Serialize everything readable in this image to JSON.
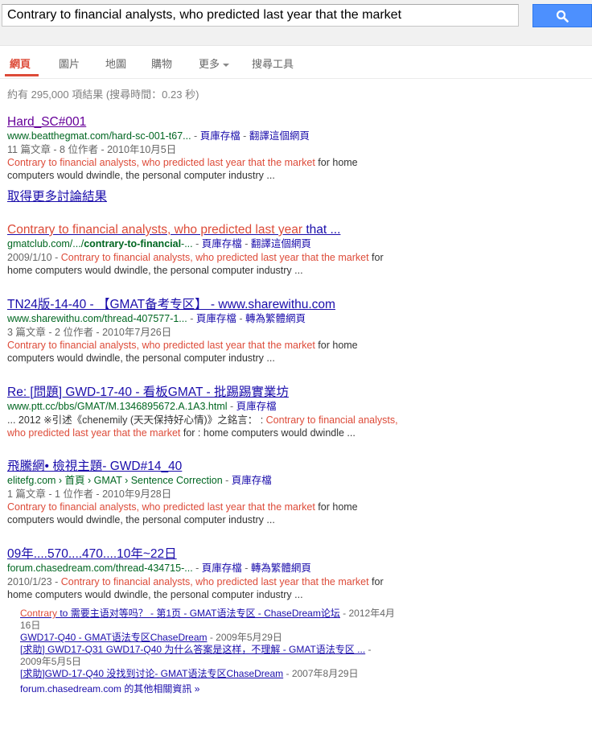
{
  "search": {
    "query": "Contrary to financial analysts, who predicted last year that the market",
    "button_icon": "search-icon",
    "accent_color": "#4d90fe"
  },
  "tabs": [
    {
      "label": "網頁",
      "active": true
    },
    {
      "label": "圖片"
    },
    {
      "label": "地圖"
    },
    {
      "label": "購物"
    },
    {
      "label": "更多"
    },
    {
      "label": "搜尋工具"
    }
  ],
  "stats": "約有 295,000 項結果 (搜尋時間：0.23 秒)",
  "results": [
    {
      "title": "Hard_SC#001",
      "url": "www.beatthegmat.com/hard-sc-001-t67...",
      "dash": " - ",
      "cache": "頁庫存檔",
      "translate": "翻譯這個網頁",
      "meta": "11 篇文章 - 8 位作者 - 2010年10月5日",
      "snip_em": "Contrary to financial analysts, who predicted last year that the market",
      "snip_rest_1": " for home",
      "snip_line2": "computers would dwindle, the personal computer industry ..."
    },
    {
      "more_discussion": "取得更多討論結果"
    },
    {
      "title_em": "Contrary to financial analysts, who predicted last year",
      "title_rest": " that ...",
      "url_prefix": "gmatclub.com/.../",
      "url_bold": "contrary-to-financial",
      "url_suffix": "-...",
      "dash": " - ",
      "cache": "頁庫存檔",
      "translate": "翻譯這個網頁",
      "date": "2009/1/10 - ",
      "snip_em": "Contrary to financial analysts, who predicted last year that the market",
      "snip_rest_1": " for",
      "snip_line2": "home computers would dwindle, the personal computer industry ..."
    },
    {
      "title": "TN24版-14-40 - 【GMAT备考专区】 - www.sharewithu.com",
      "url": "www.sharewithu.com/thread-407577-1...",
      "dash": " - ",
      "cache": "頁庫存檔",
      "translate": "轉為繁體網頁",
      "meta": "3 篇文章 - 2 位作者 - 2010年7月26日",
      "snip_em": "Contrary to financial analysts, who predicted last year that the market",
      "snip_rest_1": " for home",
      "snip_line2": "computers would dwindle, the personal computer industry ..."
    },
    {
      "title": "Re: [問題] GWD-17-40 - 看板GMAT - 批踢踢實業坊",
      "url": "www.ptt.cc/bbs/GMAT/M.1346895672.A.1A3.html",
      "dash": " - ",
      "cache": "頁庫存檔",
      "snip_pre": "... 2012 ※引述《chenemily (天天保持好心情)》之銘言： : ",
      "snip_em_a": "Contrary to financial analysts,",
      "snip_em_b": "who predicted last year that the market",
      "snip_rest": " for : home computers would dwindle ..."
    },
    {
      "title": "飛騰網• 檢視主題- GWD#14_40",
      "url_a": "elitefg.com › 首頁 › GMAT › Sentence Correction",
      "dash": " - ",
      "cache": "頁庫存檔",
      "meta": "1 篇文章 - 1 位作者 - 2010年9月28日",
      "snip_em": "Contrary to financial analysts, who predicted last year that the market",
      "snip_rest_1": " for home",
      "snip_line2": "computers would dwindle, the personal computer industry ..."
    },
    {
      "title": "09年....570....470....10年~22日",
      "url": "forum.chasedream.com/thread-434715-...",
      "dash": " - ",
      "cache": "頁庫存檔",
      "translate": "轉為繁體網頁",
      "date": "2010/1/23 - ",
      "snip_em": "Contrary to financial analysts, who predicted last year that the market",
      "snip_rest_1": " for",
      "snip_line2": "home computers would dwindle, the personal computer industry ...",
      "sublinks": [
        {
          "em": "Contrary",
          "title": " to 需要主语对等吗？ - 第1页 - GMAT语法专区 - ChaseDream论坛",
          "date": " - 2012年4月",
          "date2": "16日"
        },
        {
          "title": "GWD17-Q40 - GMAT语法专区ChaseDream",
          "date": " - 2009年5月29日"
        },
        {
          "title": "[求助] GWD17-Q31 GWD17-Q40 为什么答案是这样，不理解 - GMAT语法专区 ...",
          "date": " -",
          "date2": "2009年5月5日"
        },
        {
          "title": "[求助]GWD-17-Q40 没找到讨论- GMAT语法专区ChaseDream",
          "date": " - 2007年8月29日"
        }
      ],
      "more_from": "forum.chasedream.com 的其他相關資訊 »"
    }
  ]
}
